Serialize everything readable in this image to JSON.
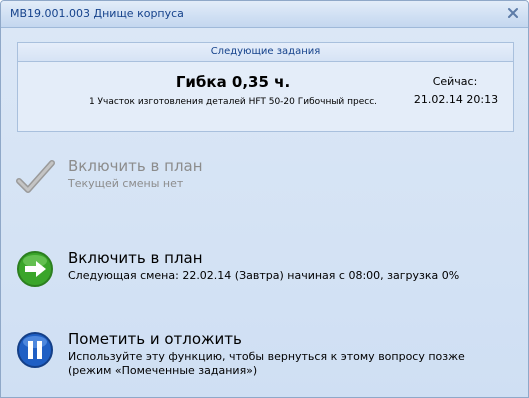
{
  "window": {
    "title": "МВ19.001.003 Днище корпуса"
  },
  "next_tasks": {
    "header": "Следующие задания",
    "task_title": "Гибка 0,35 ч.",
    "task_description": "1 Участок изготовления деталей HFT 50-20 Гибочный пресс.",
    "now_label": "Сейчас:",
    "now_value": "21.02.14 20:13"
  },
  "actions": [
    {
      "label": "Включить в план",
      "description": "Текущей смены нет",
      "enabled": false,
      "icon": "checkmark-icon"
    },
    {
      "label": "Включить в план",
      "description": "Следующая смена: 22.02.14 (Завтра) начиная с 08:00, загрузка 0%",
      "enabled": true,
      "icon": "arrow-right-icon"
    },
    {
      "label": "Пометить и отложить",
      "description": "Используйте эту функцию, чтобы вернуться к этому вопросу позже (режим «Помеченные задания»)",
      "enabled": true,
      "icon": "pause-icon"
    }
  ],
  "colors": {
    "window_bg": "#d3e2f5",
    "title_text": "#15428b",
    "disabled_text": "#8c8c8c",
    "green_accent": "#3aa52a",
    "blue_accent": "#1f5fc4"
  }
}
